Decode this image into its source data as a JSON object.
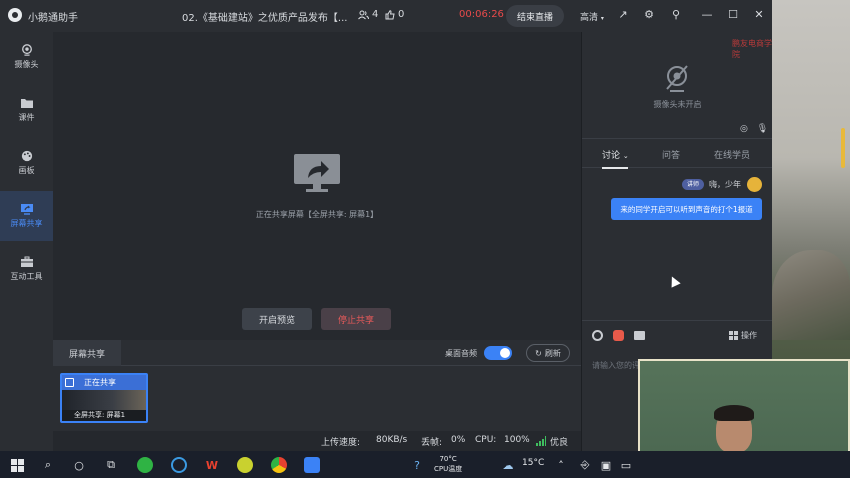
{
  "titlebar": {
    "app_name": "小鹅通助手",
    "course_title": "02.《基础建站》之优质产品发布【...",
    "viewers_count": "4",
    "likes_count": "0",
    "timer": "00:06:26",
    "end_live_label": "结束直播",
    "quality_label": "高清"
  },
  "sidebar": {
    "items": [
      {
        "label": "摄像头",
        "icon": "camera-icon"
      },
      {
        "label": "课件",
        "icon": "folder-icon"
      },
      {
        "label": "画板",
        "icon": "palette-icon"
      },
      {
        "label": "屏幕共享",
        "icon": "screen-share-icon",
        "active": true
      },
      {
        "label": "互动工具",
        "icon": "toolbox-icon"
      }
    ]
  },
  "stage": {
    "share_status": "正在共享屏幕【全屏共享: 屏幕1】",
    "preview_button": "开启预览",
    "stop_share_button": "停止共享"
  },
  "share_panel": {
    "tab_label": "屏幕共享",
    "desktop_audio_label": "桌面音频",
    "desktop_audio_on": true,
    "refresh_label": "刷新",
    "thumbnail": {
      "status": "正在共享",
      "caption": "全屏共享: 屏幕1"
    }
  },
  "statusbar": {
    "upload_label": "上传速度:",
    "upload_value": "80KB/s",
    "drop_label": "丢帧:",
    "drop_value": "0%",
    "cpu_label": "CPU:",
    "cpu_value": "100%",
    "quality_value": "优良"
  },
  "right_panel": {
    "camera_off_text": "摄像头未开启",
    "brand_text": "鹏友电商学院",
    "tabs": [
      {
        "label": "讨论",
        "active": true
      },
      {
        "label": "问答"
      },
      {
        "label": "在线学员"
      }
    ],
    "message": {
      "role": "讲师",
      "name": "嗨，少年",
      "text": "来的同学开启可以听到声音的打个1报道"
    },
    "operations_label": "操作",
    "input_placeholder": "请输入您的评论"
  },
  "taskbar": {
    "temperature": "70°C",
    "cpu_temp_label": "CPU温度",
    "weather": "15°C"
  },
  "colors": {
    "accent": "#3b82f6",
    "danger": "#e84a4a",
    "avatar": "#e6b33a"
  }
}
